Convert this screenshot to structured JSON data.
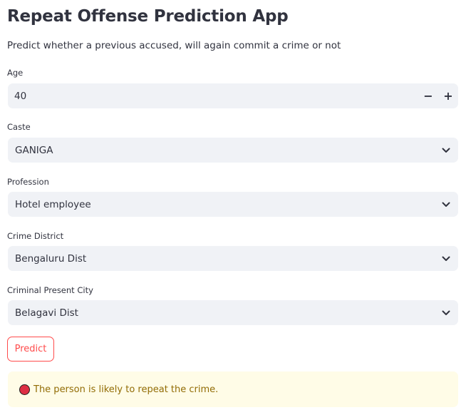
{
  "app": {
    "title": "Repeat Offense Prediction App",
    "subtitle": "Predict whether a previous accused, will again commit a crime or not"
  },
  "form": {
    "age": {
      "label": "Age",
      "value": "40",
      "decrement": "−",
      "increment": "+"
    },
    "caste": {
      "label": "Caste",
      "value": "GANIGA"
    },
    "profession": {
      "label": "Profession",
      "value": "Hotel employee"
    },
    "crime_district": {
      "label": "Crime District",
      "value": "Bengaluru Dist"
    },
    "present_city": {
      "label": "Criminal Present City",
      "value": "Belagavi Dist"
    },
    "predict_label": "Predict"
  },
  "result": {
    "icon": "red-circle-icon",
    "text": "The person is likely to repeat the crime."
  },
  "colors": {
    "accent": "#ff4b4b",
    "input_bg": "#f0f2f6",
    "warning_bg": "#fffce7",
    "warning_text": "#926c05",
    "text": "#31333F"
  }
}
